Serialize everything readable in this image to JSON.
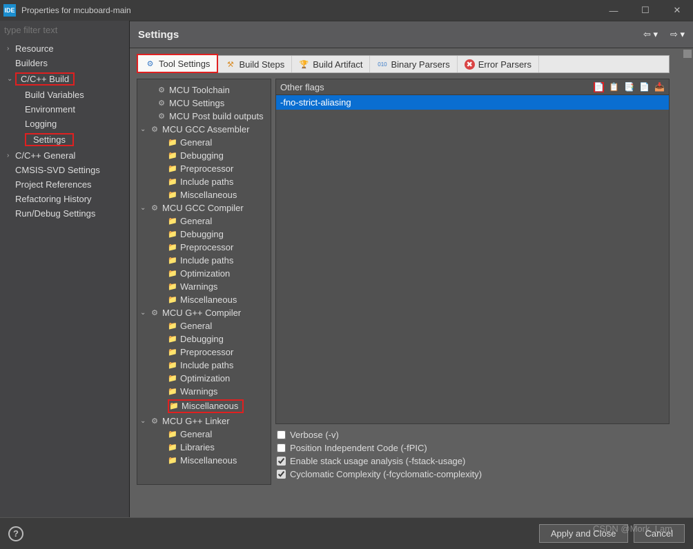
{
  "window": {
    "app_icon": "IDE",
    "title": "Properties for mcuboard-main"
  },
  "filter": {
    "placeholder": "type filter text"
  },
  "left_nav": {
    "items": [
      {
        "label": "Resource",
        "expandable": true
      },
      {
        "label": "Builders",
        "expandable": false
      },
      {
        "label": "C/C++ Build",
        "expandable": true,
        "hl": true,
        "children": [
          {
            "label": "Build Variables"
          },
          {
            "label": "Environment"
          },
          {
            "label": "Logging"
          },
          {
            "label": "Settings",
            "hl": true
          }
        ]
      },
      {
        "label": "C/C++ General",
        "expandable": true
      },
      {
        "label": "CMSIS-SVD Settings"
      },
      {
        "label": "Project References"
      },
      {
        "label": "Refactoring History"
      },
      {
        "label": "Run/Debug Settings"
      }
    ]
  },
  "header": {
    "title": "Settings"
  },
  "tabs": [
    {
      "label": "Tool Settings"
    },
    {
      "label": "Build Steps"
    },
    {
      "label": "Build Artifact"
    },
    {
      "label": "Binary Parsers"
    },
    {
      "label": "Error Parsers"
    }
  ],
  "tool_tree": [
    {
      "l": 2,
      "icon": "gear",
      "label": "MCU Toolchain"
    },
    {
      "l": 2,
      "icon": "gear",
      "label": "MCU Settings"
    },
    {
      "l": 2,
      "icon": "gear",
      "label": "MCU Post build outputs"
    },
    {
      "l": 1,
      "icon": "gear",
      "label": "MCU GCC Assembler",
      "open": true
    },
    {
      "l": 3,
      "icon": "folder",
      "label": "General"
    },
    {
      "l": 3,
      "icon": "folder",
      "label": "Debugging"
    },
    {
      "l": 3,
      "icon": "folder",
      "label": "Preprocessor"
    },
    {
      "l": 3,
      "icon": "folder",
      "label": "Include paths"
    },
    {
      "l": 3,
      "icon": "folder",
      "label": "Miscellaneous"
    },
    {
      "l": 1,
      "icon": "gear",
      "label": "MCU GCC Compiler",
      "open": true
    },
    {
      "l": 3,
      "icon": "folder",
      "label": "General"
    },
    {
      "l": 3,
      "icon": "folder",
      "label": "Debugging"
    },
    {
      "l": 3,
      "icon": "folder",
      "label": "Preprocessor"
    },
    {
      "l": 3,
      "icon": "folder",
      "label": "Include paths"
    },
    {
      "l": 3,
      "icon": "folder",
      "label": "Optimization"
    },
    {
      "l": 3,
      "icon": "folder",
      "label": "Warnings"
    },
    {
      "l": 3,
      "icon": "folder",
      "label": "Miscellaneous"
    },
    {
      "l": 1,
      "icon": "gear",
      "label": "MCU G++ Compiler",
      "open": true
    },
    {
      "l": 3,
      "icon": "folder",
      "label": "General"
    },
    {
      "l": 3,
      "icon": "folder",
      "label": "Debugging"
    },
    {
      "l": 3,
      "icon": "folder",
      "label": "Preprocessor"
    },
    {
      "l": 3,
      "icon": "folder",
      "label": "Include paths"
    },
    {
      "l": 3,
      "icon": "folder",
      "label": "Optimization"
    },
    {
      "l": 3,
      "icon": "folder",
      "label": "Warnings"
    },
    {
      "l": 3,
      "icon": "folder",
      "label": "Miscellaneous",
      "hl": true
    },
    {
      "l": 1,
      "icon": "gear",
      "label": "MCU G++ Linker",
      "open": true
    },
    {
      "l": 3,
      "icon": "folder",
      "label": "General"
    },
    {
      "l": 3,
      "icon": "folder",
      "label": "Libraries"
    },
    {
      "l": 3,
      "icon": "folder",
      "label": "Miscellaneous"
    }
  ],
  "flags": {
    "header": "Other flags",
    "items": [
      "-fno-strict-aliasing"
    ]
  },
  "checks": [
    {
      "label": "Verbose (-v)",
      "checked": false
    },
    {
      "label": "Position Independent Code (-fPIC)",
      "checked": false
    },
    {
      "label": "Enable stack usage analysis (-fstack-usage)",
      "checked": true
    },
    {
      "label": "Cyclomatic Complexity (-fcyclomatic-complexity)",
      "checked": true
    }
  ],
  "buttons": {
    "apply": "Apply and Close",
    "cancel": "Cancel"
  },
  "watermark": "CSDN @Mork, Lam"
}
